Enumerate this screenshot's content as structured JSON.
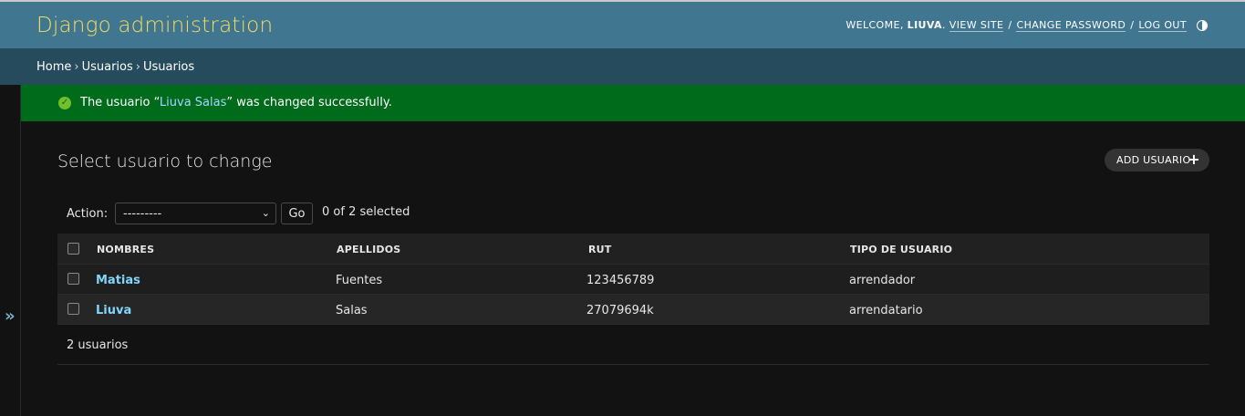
{
  "header": {
    "site_name": "Django administration",
    "welcome_text": "WELCOME,",
    "username": "LIUVA",
    "links": [
      "VIEW SITE",
      "CHANGE PASSWORD",
      "LOG OUT"
    ]
  },
  "breadcrumbs": [
    "Home",
    "Usuarios",
    "Usuarios"
  ],
  "message": {
    "before": "The usuario “",
    "link": "Liuva Salas",
    "after": "” was changed successfully."
  },
  "page": {
    "title": "Select usuario to change",
    "add_button": "ADD USUARIO"
  },
  "actions": {
    "label": "Action:",
    "selected_option": "---------",
    "go_label": "Go",
    "selected_count": "0 of 2 selected"
  },
  "table": {
    "columns": [
      "NOMBRES",
      "APELLIDOS",
      "RUT",
      "TIPO DE USUARIO"
    ],
    "rows": [
      {
        "nombres": "Matias",
        "apellidos": "Fuentes",
        "rut": "123456789",
        "tipo": "arrendador"
      },
      {
        "nombres": "Liuva",
        "apellidos": "Salas",
        "rut": "27079694k",
        "tipo": "arrendatario"
      }
    ]
  },
  "paginator": "2 usuarios",
  "colors": {
    "header_bg": "#417690",
    "breadcrumbs_bg": "#264b5d",
    "brand": "#f5dd5d",
    "success_bg": "#006b1b",
    "link": "#81d4fa"
  },
  "icons": {
    "theme_toggle": "half-circle-contrast-icon",
    "success": "check-circle-icon",
    "add": "plus-icon",
    "nav_toggle": "double-chevron-right-icon",
    "select": "chevron-down-icon"
  }
}
